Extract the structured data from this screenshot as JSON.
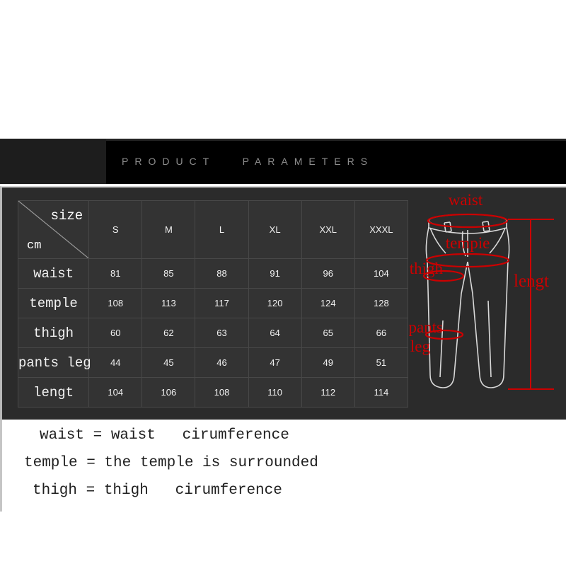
{
  "banner": {
    "title": "PRODUCT   PARAMETERS",
    "bg_color": "#000000",
    "left_block_color": "#1d1d1d",
    "text_color": "#8e8e8e"
  },
  "panel": {
    "bg_color": "#2b2b2b"
  },
  "size_table": {
    "corner": {
      "size_label": "size",
      "unit_label": "cm"
    },
    "size_headers": [
      "S",
      "M",
      "L",
      "XL",
      "XXL",
      "XXXL"
    ],
    "rows": [
      {
        "label": "waist",
        "values": [
          "81",
          "85",
          "88",
          "91",
          "96",
          "104"
        ]
      },
      {
        "label": "temple",
        "values": [
          "108",
          "113",
          "117",
          "120",
          "124",
          "128"
        ]
      },
      {
        "label": "thigh",
        "values": [
          "60",
          "62",
          "63",
          "64",
          "65",
          "66"
        ]
      },
      {
        "label": "pants leg",
        "values": [
          "44",
          "45",
          "46",
          "47",
          "49",
          "51"
        ]
      },
      {
        "label": "lengt",
        "values": [
          "104",
          "106",
          "108",
          "110",
          "112",
          "114"
        ]
      }
    ]
  },
  "diagram": {
    "annotation_color": "#cc0000",
    "outline_color": "#d9d9d9",
    "labels": {
      "waist": "waist",
      "temple": "tempie",
      "thigh": "thigh",
      "pants_leg_line1": "pants",
      "pants_leg_line2": "leg",
      "length": "lengt"
    }
  },
  "legend": {
    "lines": [
      "waist = waist   cirumference",
      "temple = the temple is surrounded",
      "thigh = thigh   cirumference"
    ]
  },
  "chart_data": {
    "type": "table",
    "title": "PRODUCT   PARAMETERS",
    "unit": "cm",
    "categories": [
      "S",
      "M",
      "L",
      "XL",
      "XXL",
      "XXXL"
    ],
    "series": [
      {
        "name": "waist",
        "values": [
          81,
          85,
          88,
          91,
          96,
          104
        ]
      },
      {
        "name": "temple",
        "values": [
          108,
          113,
          117,
          120,
          124,
          128
        ]
      },
      {
        "name": "thigh",
        "values": [
          60,
          62,
          63,
          64,
          65,
          66
        ]
      },
      {
        "name": "pants leg",
        "values": [
          44,
          45,
          46,
          47,
          49,
          51
        ]
      },
      {
        "name": "lengt",
        "values": [
          104,
          106,
          108,
          110,
          112,
          114
        ]
      }
    ],
    "xlabel": "size",
    "ylabel": "cm",
    "notes": [
      "waist = waist   cirumference",
      "temple = the temple is surrounded",
      "thigh = thigh   cirumference"
    ]
  }
}
